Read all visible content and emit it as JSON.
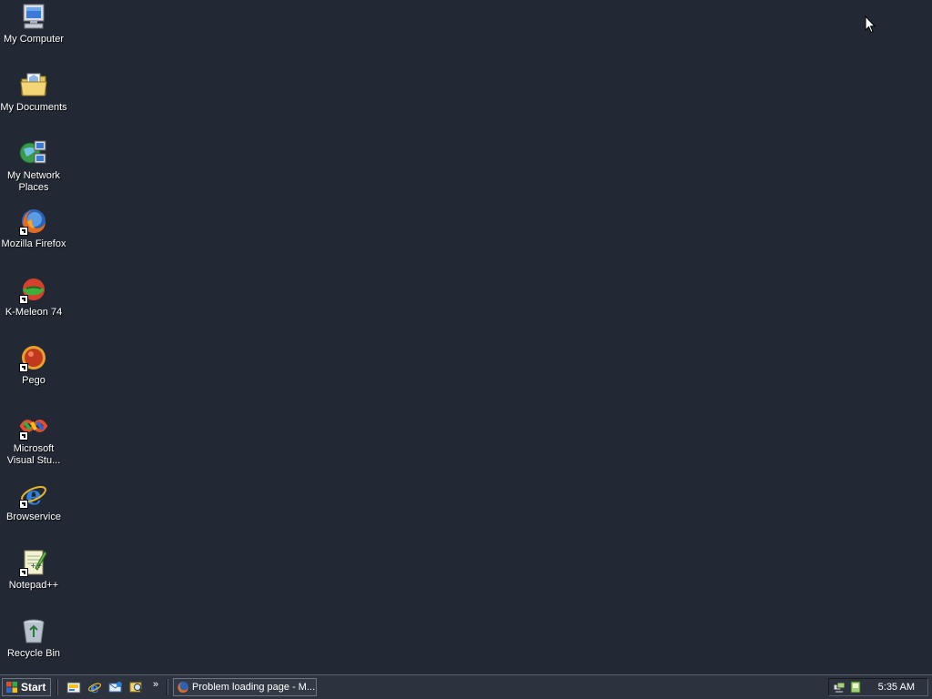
{
  "desktop": {
    "background_color": "#232934",
    "icons": [
      {
        "label": "My Computer",
        "icon": "computer-icon"
      },
      {
        "label": "My Documents",
        "icon": "documents-folder-icon"
      },
      {
        "label": "My Network Places",
        "icon": "network-places-icon"
      },
      {
        "label": "Mozilla Firefox",
        "icon": "firefox-icon"
      },
      {
        "label": "K-Meleon 74",
        "icon": "kmeleon-icon"
      },
      {
        "label": "Pego",
        "icon": "pego-icon"
      },
      {
        "label": "Microsoft Visual Stu...",
        "icon": "visual-studio-icon"
      },
      {
        "label": "Browservice",
        "icon": "internet-explorer-icon"
      },
      {
        "label": "Notepad++",
        "icon": "notepadpp-icon"
      },
      {
        "label": "Recycle Bin",
        "icon": "recycle-bin-icon"
      }
    ]
  },
  "taskbar": {
    "start_label": "Start",
    "quick_launch": [
      "show-desktop-icon",
      "internet-explorer-icon",
      "outlook-express-icon",
      "search-icon"
    ],
    "overflow_label": "»",
    "tasks": [
      {
        "label": "Problem loading page - M...",
        "icon": "firefox-icon"
      }
    ],
    "tray": {
      "icons": [
        "network-tray-icon",
        "notification-tray-icon"
      ],
      "clock": "5:35 AM"
    }
  }
}
